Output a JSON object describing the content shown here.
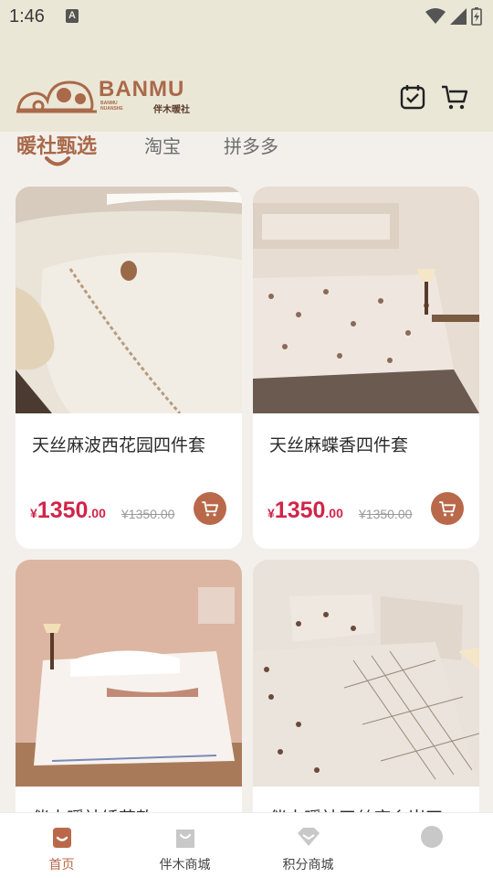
{
  "status_bar": {
    "time": "1:46",
    "notification": "A"
  },
  "header": {
    "brand": "BANMU",
    "brand_sub": "BANMU NUANSHE",
    "brand_cn": "伴木暖社",
    "calendar_icon": "calendar-check-icon",
    "cart_icon": "cart-icon"
  },
  "tabs": [
    {
      "label": "暖社甄选",
      "active": true
    },
    {
      "label": "淘宝",
      "active": false
    },
    {
      "label": "拼多多",
      "active": false
    }
  ],
  "products": [
    {
      "title": "天丝麻波西花园四件套",
      "currency": "¥",
      "price_int": "1350",
      "price_dec": ".00",
      "old_price": "¥1350.00"
    },
    {
      "title": "天丝麻蝶香四件套",
      "currency": "¥",
      "price_int": "1350",
      "price_dec": ".00",
      "old_price": "¥1350.00"
    },
    {
      "title": "伴木暖社绣花款"
    },
    {
      "title": "伴木暖社天丝麻乡岸四"
    }
  ],
  "bottom_nav": [
    {
      "label": "首页",
      "icon": "home-bag-icon",
      "active": true
    },
    {
      "label": "伴木商城",
      "icon": "shopping-bag-icon",
      "active": false
    },
    {
      "label": "积分商城",
      "icon": "diamond-icon",
      "active": false
    },
    {
      "label": "",
      "icon": "profile-icon",
      "active": false
    }
  ],
  "colors": {
    "accent": "#b9694a",
    "price": "#d0254a",
    "header_bg": "#ebe7d6",
    "page_bg": "#f3f0ec"
  }
}
